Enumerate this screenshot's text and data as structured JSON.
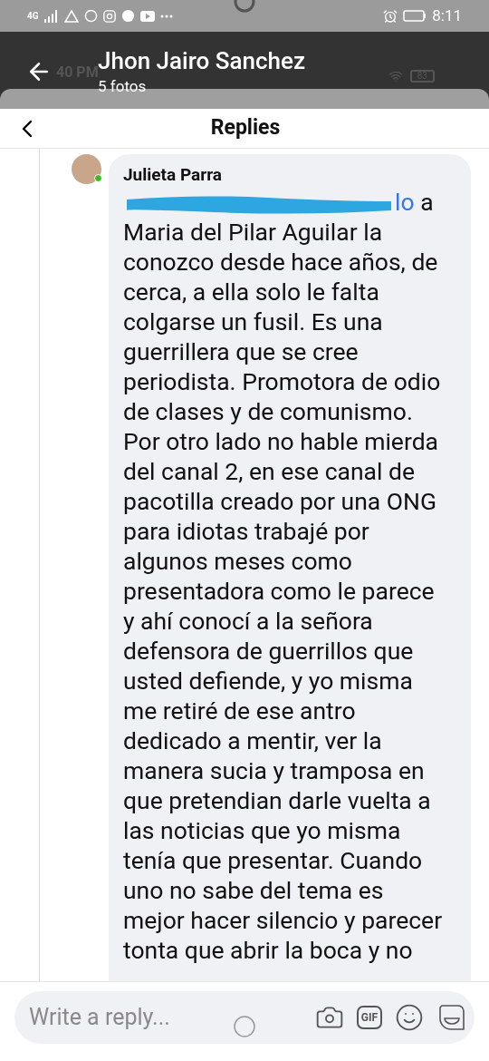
{
  "status_bar": {
    "network": "4G",
    "time": "8:11"
  },
  "viewer": {
    "title": "Jhon Jairo Sanchez",
    "subtitle": "5 fotos"
  },
  "inner_status": {
    "time": "40 PM",
    "battery": "83"
  },
  "header": {
    "title": "Replies"
  },
  "comment": {
    "author": "Julieta Parra",
    "online": true,
    "mention_tail": "lo",
    "text": "a Maria del Pilar Aguilar la conozco desde hace años, de cerca, a ella solo le falta colgarse un fusil. Es una guerrillera que se cree periodista. Promotora de odio de clases y de comunismo. Por otro lado no hable mierda del canal 2, en ese canal de pacotilla creado por una ONG para idiotas trabajé por algunos meses como presentadora como le parece y ahí conocí a la señora defensora de guerrillos que usted defiende, y yo misma me retiré de ese antro dedicado a mentir, ver la manera sucia y tramposa en que pretendian darle vuelta a las noticias que yo misma tenía que presentar. Cuando uno no sabe del tema es mejor hacer silencio y parecer tonta que abrir la boca y no"
  },
  "reply_bar": {
    "placeholder": "Write a reply...",
    "gif_label": "GIF"
  }
}
